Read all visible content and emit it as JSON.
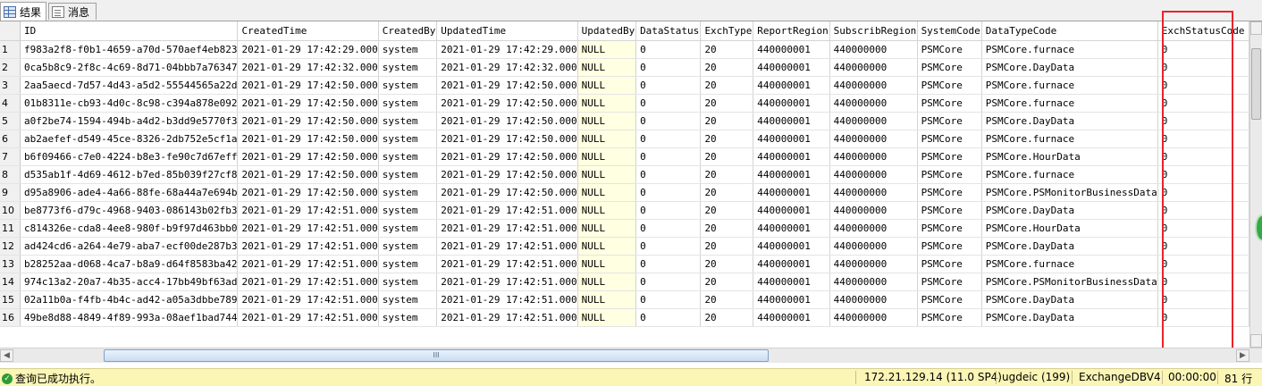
{
  "tabs": [
    {
      "label": "结果",
      "icon": "grid-icon",
      "active": true
    },
    {
      "label": "消息",
      "icon": "message-icon",
      "active": false
    }
  ],
  "columns": [
    "ID",
    "CreatedTime",
    "CreatedBy",
    "UpdatedTime",
    "UpdatedBy",
    "DataStatus",
    "ExchType",
    "ReportRegion",
    "SubscribRegion",
    "SystemCode",
    "DataTypeCode",
    "ExchStatusCode"
  ],
  "rows": [
    [
      "1",
      "f983a2f8-f0b1-4659-a70d-570aef4eb823",
      "2021-01-29 17:42:29.000",
      "system",
      "2021-01-29 17:42:29.000",
      "NULL",
      "0",
      "20",
      "440000001",
      "440000000",
      "PSMCore",
      "PSMCore.furnace",
      "0"
    ],
    [
      "2",
      "0ca5b8c9-2f8c-4c69-8d71-04bbb7a76347",
      "2021-01-29 17:42:32.000",
      "system",
      "2021-01-29 17:42:32.000",
      "NULL",
      "0",
      "20",
      "440000001",
      "440000000",
      "PSMCore",
      "PSMCore.DayData",
      "0"
    ],
    [
      "3",
      "2aa5aecd-7d57-4d43-a5d2-55544565a22d",
      "2021-01-29 17:42:50.000",
      "system",
      "2021-01-29 17:42:50.000",
      "NULL",
      "0",
      "20",
      "440000001",
      "440000000",
      "PSMCore",
      "PSMCore.furnace",
      "0"
    ],
    [
      "4",
      "01b8311e-cb93-4d0c-8c98-c394a878e092",
      "2021-01-29 17:42:50.000",
      "system",
      "2021-01-29 17:42:50.000",
      "NULL",
      "0",
      "20",
      "440000001",
      "440000000",
      "PSMCore",
      "PSMCore.furnace",
      "0"
    ],
    [
      "5",
      "a0f2be74-1594-494b-a4d2-b3dd9e5770f3",
      "2021-01-29 17:42:50.000",
      "system",
      "2021-01-29 17:42:50.000",
      "NULL",
      "0",
      "20",
      "440000001",
      "440000000",
      "PSMCore",
      "PSMCore.DayData",
      "0"
    ],
    [
      "6",
      "ab2aefef-d549-45ce-8326-2db752e5cf1a",
      "2021-01-29 17:42:50.000",
      "system",
      "2021-01-29 17:42:50.000",
      "NULL",
      "0",
      "20",
      "440000001",
      "440000000",
      "PSMCore",
      "PSMCore.furnace",
      "0"
    ],
    [
      "7",
      "b6f09466-c7e0-4224-b8e3-fe90c7d67eff",
      "2021-01-29 17:42:50.000",
      "system",
      "2021-01-29 17:42:50.000",
      "NULL",
      "0",
      "20",
      "440000001",
      "440000000",
      "PSMCore",
      "PSMCore.HourData",
      "0"
    ],
    [
      "8",
      "d535ab1f-4d69-4612-b7ed-85b039f27cf8",
      "2021-01-29 17:42:50.000",
      "system",
      "2021-01-29 17:42:50.000",
      "NULL",
      "0",
      "20",
      "440000001",
      "440000000",
      "PSMCore",
      "PSMCore.furnace",
      "0"
    ],
    [
      "9",
      "d95a8906-ade4-4a66-88fe-68a44a7e694b",
      "2021-01-29 17:42:50.000",
      "system",
      "2021-01-29 17:42:50.000",
      "NULL",
      "0",
      "20",
      "440000001",
      "440000000",
      "PSMCore",
      "PSMCore.PSMonitorBusinessData",
      "0"
    ],
    [
      "10",
      "be8773f6-d79c-4968-9403-086143b02fb3",
      "2021-01-29 17:42:51.000",
      "system",
      "2021-01-29 17:42:51.000",
      "NULL",
      "0",
      "20",
      "440000001",
      "440000000",
      "PSMCore",
      "PSMCore.DayData",
      "0"
    ],
    [
      "11",
      "c814326e-cda8-4ee8-980f-b9f97d463bb0",
      "2021-01-29 17:42:51.000",
      "system",
      "2021-01-29 17:42:51.000",
      "NULL",
      "0",
      "20",
      "440000001",
      "440000000",
      "PSMCore",
      "PSMCore.HourData",
      "0"
    ],
    [
      "12",
      "ad424cd6-a264-4e79-aba7-ecf00de287b3",
      "2021-01-29 17:42:51.000",
      "system",
      "2021-01-29 17:42:51.000",
      "NULL",
      "0",
      "20",
      "440000001",
      "440000000",
      "PSMCore",
      "PSMCore.DayData",
      "0"
    ],
    [
      "13",
      "b28252aa-d068-4ca7-b8a9-d64f8583ba42",
      "2021-01-29 17:42:51.000",
      "system",
      "2021-01-29 17:42:51.000",
      "NULL",
      "0",
      "20",
      "440000001",
      "440000000",
      "PSMCore",
      "PSMCore.furnace",
      "0"
    ],
    [
      "14",
      "974c13a2-20a7-4b35-acc4-17bb49bf63ad",
      "2021-01-29 17:42:51.000",
      "system",
      "2021-01-29 17:42:51.000",
      "NULL",
      "0",
      "20",
      "440000001",
      "440000000",
      "PSMCore",
      "PSMCore.PSMonitorBusinessData",
      "0"
    ],
    [
      "15",
      "02a11b0a-f4fb-4b4c-ad42-a05a3dbbe789",
      "2021-01-29 17:42:51.000",
      "system",
      "2021-01-29 17:42:51.000",
      "NULL",
      "0",
      "20",
      "440000001",
      "440000000",
      "PSMCore",
      "PSMCore.DayData",
      "0"
    ],
    [
      "16",
      "49be8d88-4849-4f89-993a-08aef1bad744",
      "2021-01-29 17:42:51.000",
      "system",
      "2021-01-29 17:42:51.000",
      "NULL",
      "0",
      "20",
      "440000001",
      "440000000",
      "PSMCore",
      "PSMCore.DayData",
      "0"
    ]
  ],
  "hscroll_thumb_label": "III",
  "status": {
    "message": "查询已成功执行。",
    "server": "172.21.129.14 (11.0 SP4)",
    "user": "ugdeic (199)",
    "database": "ExchangeDBV4",
    "elapsed": "00:00:00",
    "rowcount": "81 行"
  },
  "colors": {
    "highlight_box": "#e8242c",
    "null_bg": "#ffffe1",
    "status_bg": "#fbf5b6"
  }
}
